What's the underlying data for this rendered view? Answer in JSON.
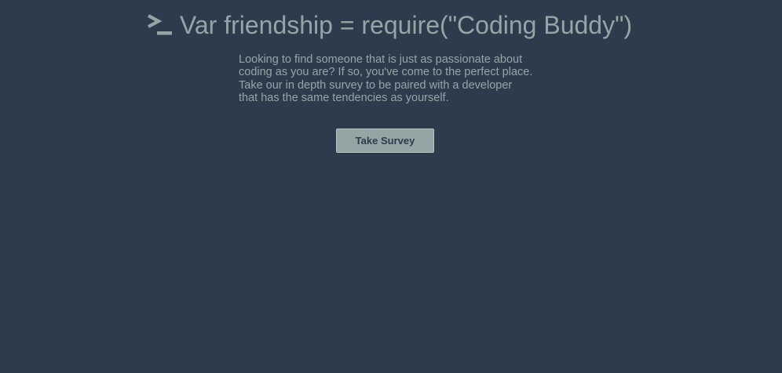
{
  "header": {
    "icon": "terminal-prompt-icon",
    "title": "Var friendship = require(\"Coding Buddy\")"
  },
  "intro": {
    "lines": [
      "Looking to find someone that is just as passionate about",
      "coding as you are? If so, you've come to the perfect place.",
      "Take our in depth survey to be paired with a developer",
      "that has the same tendencies as yourself."
    ]
  },
  "actions": {
    "survey_label": "Take Survey"
  },
  "colors": {
    "background": "#2d3b4d",
    "text": "#95a5a6",
    "button_bg": "#95a5a6",
    "button_text": "#2d3b4d"
  }
}
